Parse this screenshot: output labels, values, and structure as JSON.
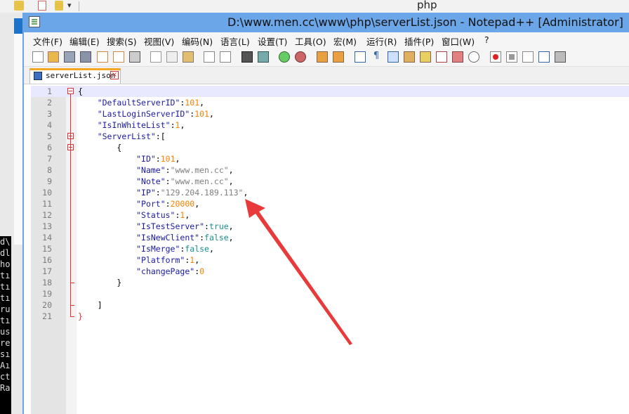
{
  "background": {
    "window_title": "php",
    "console_lines": [
      "d\\",
      "dl",
      "ho",
      "tı",
      "tı",
      "tı",
      "ru",
      "tı",
      "us",
      "re",
      "sı",
      "Aı",
      "ct",
      "Ra"
    ]
  },
  "window": {
    "title": "D:\\www.men.cc\\www\\php\\serverList.json - Notepad++ [Administrator]"
  },
  "menu": [
    "文件(F)",
    "编辑(E)",
    "搜索(S)",
    "视图(V)",
    "编码(N)",
    "语言(L)",
    "设置(T)",
    "工具(O)",
    "宏(M)",
    "运行(R)",
    "插件(P)",
    "窗口(W)",
    "?"
  ],
  "tab": {
    "label": "serverList.json"
  },
  "editor": {
    "line_numbers": [
      "1",
      "2",
      "3",
      "4",
      "5",
      "6",
      "7",
      "8",
      "9",
      "10",
      "11",
      "12",
      "13",
      "14",
      "15",
      "16",
      "17",
      "18",
      "19",
      "20",
      "21"
    ]
  },
  "colors": {
    "title_bar": "#6aa6e8",
    "keyword": "#1a1aa6",
    "number": "#ff8000",
    "string": "#808080",
    "boolean": "#1a8f8f",
    "annotation_arrow": "#e83a3a"
  }
}
